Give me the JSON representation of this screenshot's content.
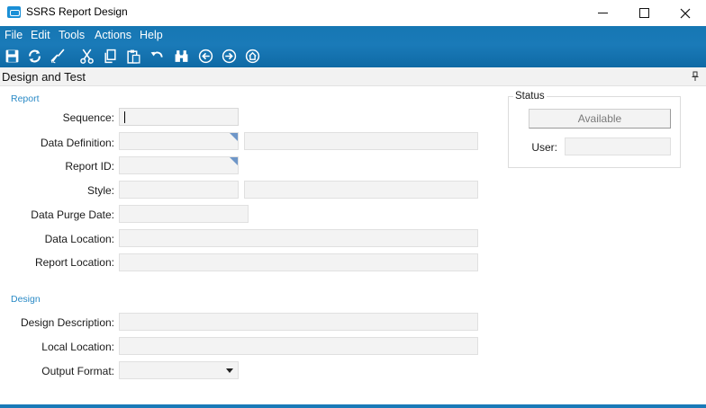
{
  "window": {
    "title": "SSRS Report Design"
  },
  "menu": [
    "File",
    "Edit",
    "Tools",
    "Actions",
    "Help"
  ],
  "toolbar": {
    "icons": [
      "save-icon",
      "refresh-icon",
      "clear-icon",
      "cut-icon",
      "copy-icon",
      "paste-icon",
      "undo-icon",
      "search-icon",
      "back-icon",
      "forward-icon",
      "home-icon"
    ]
  },
  "panel": {
    "title": "Design and Test"
  },
  "report": {
    "section": "Report",
    "sequence_label": "Sequence:",
    "data_definition_label": "Data Definition:",
    "report_id_label": "Report ID:",
    "style_label": "Style:",
    "data_purge_date_label": "Data Purge Date:",
    "data_location_label": "Data Location:",
    "report_location_label": "Report Location:"
  },
  "design": {
    "section": "Design",
    "design_description_label": "Design Description:",
    "local_location_label": "Local Location:",
    "output_format_label": "Output Format:"
  },
  "status": {
    "title": "Status",
    "button_label": "Available",
    "user_label": "User:"
  },
  "colors": {
    "accent": "#1a7ab8",
    "section_label": "#2a8ac6",
    "field_bg": "#f3f3f3"
  }
}
